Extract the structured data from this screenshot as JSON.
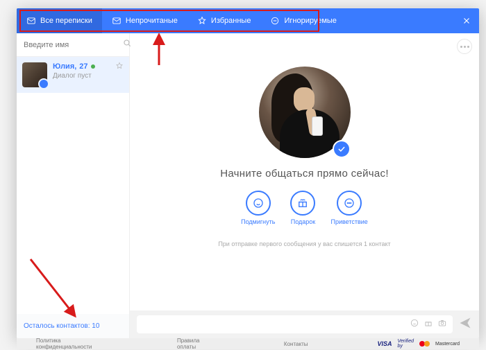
{
  "tabs": {
    "all": "Все переписки",
    "unread": "Непрочитаные",
    "favorite": "Избранные",
    "ignored": "Игнорируемые"
  },
  "search": {
    "placeholder": "Введите имя"
  },
  "contact": {
    "name": "Юлия,",
    "age": "27",
    "sub": "Диалог пуст"
  },
  "remaining": {
    "label": "Осталось контактов: ",
    "count": "10"
  },
  "main": {
    "prompt": "Начните общаться прямо сейчас!",
    "note": "При отправке первого сообщения у вас спишется 1 контакт"
  },
  "actions": {
    "wink": "Подмигнуть",
    "gift": "Подарок",
    "greet": "Приветствие"
  },
  "footer": {
    "privacy": "Политика конфиденциальности",
    "payment": "Правила оплаты",
    "contacts": "Контакты",
    "verified": "Verified by",
    "mastercard": "Mastercard"
  }
}
